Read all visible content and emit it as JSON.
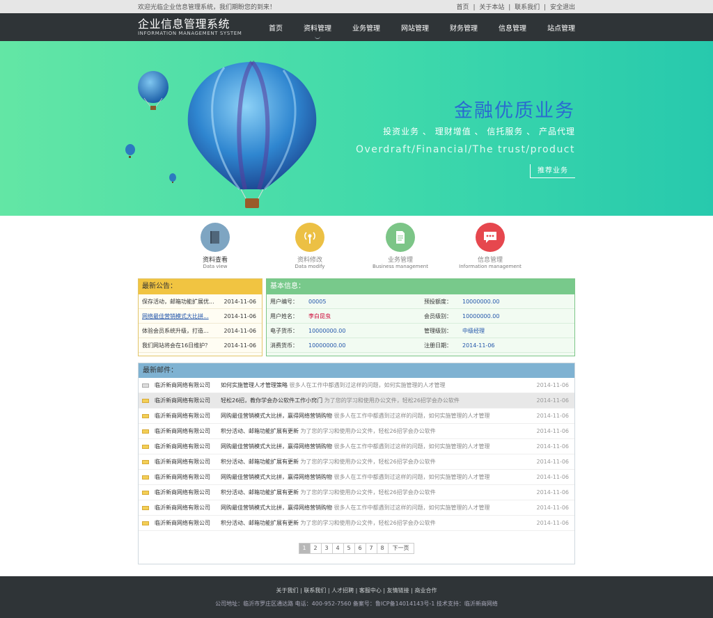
{
  "topbar": {
    "welcome": "欢迎光临企业信息管理系统，我们期盼您的到来！",
    "links": [
      "首页",
      "|",
      "关于本站",
      "|",
      "联系我们",
      "|",
      "安全退出"
    ]
  },
  "header": {
    "title": "企业信息管理系统",
    "subtitle": "INFORMATION MANAGEMENT SYSTEM"
  },
  "nav": [
    "首页",
    "资料管理",
    "业务管理",
    "网站管理",
    "财务管理",
    "信息管理",
    "站点管理"
  ],
  "banner": {
    "title": "金融优质业务",
    "services": "投资业务 、 理财增值 、 信托服务 、 产品代理",
    "english": "Overdraft/Financial/The trust/product",
    "button": "推荐业务"
  },
  "features": [
    {
      "cn": "资料查看",
      "en": "Data view",
      "color": "#7ea5c2",
      "icon": "book-icon"
    },
    {
      "cn": "资料修改",
      "en": "Data modify",
      "color": "#ecc044",
      "icon": "signal-icon"
    },
    {
      "cn": "业务管理",
      "en": "Business management",
      "color": "#7cc587",
      "icon": "document-icon"
    },
    {
      "cn": "信息管理",
      "en": "Information management",
      "color": "#e6474e",
      "icon": "chat-icon"
    }
  ],
  "notice": {
    "title": "最新公告：",
    "rows": [
      {
        "text": "保存活动，邮箱功能扩展优...",
        "date": "2014-11-06"
      },
      {
        "text": "网络最佳营销模式大比拼...",
        "date": "2014-11-06"
      },
      {
        "text": "体验会员系统升级，打造...",
        "date": "2014-11-06"
      },
      {
        "text": "我们网站将会在16日维护？",
        "date": "2014-11-06"
      }
    ]
  },
  "info": {
    "title": "基本信息：",
    "rows": [
      [
        {
          "k": "用户编号：",
          "v": "00005"
        },
        {
          "k": "预投额度：",
          "v": "10000000.00"
        }
      ],
      [
        {
          "k": "用户姓名：",
          "v": "李白昆虫"
        },
        {
          "k": "会员级别：",
          "v": "10000000.00"
        }
      ],
      [
        {
          "k": "电子货币：",
          "v": "10000000.00"
        },
        {
          "k": "管理级别：",
          "v": "中级经理"
        }
      ],
      [
        {
          "k": "消费货币：",
          "v": "10000000.00"
        },
        {
          "k": "注册日期：",
          "v": "2014-11-06"
        }
      ]
    ]
  },
  "mails": {
    "title": "最新邮件：",
    "rows": [
      {
        "company": "临沂新商网络有限公司",
        "bold": "如何实施管理人才管理策略",
        "rest": "  很多人在工作中都遇到过这样的问题，如何实施管理的人才管理",
        "date": "2014-11-06"
      },
      {
        "company": "临沂新商网络有限公司",
        "bold": "轻松26招，教你学会办公软件工作小窍门",
        "rest": "  为了您的学习和使用办公文件，轻松26招学会办公软件",
        "date": "2014-11-06"
      },
      {
        "company": "临沂新商网络有限公司",
        "bold": "网购最佳营销模式大比拼，赢得网络营销购物",
        "rest": "  很多人在工作中都遇到过这样的问题，如何实施管理的人才管理",
        "date": "2014-11-06"
      },
      {
        "company": "临沂新商网络有限公司",
        "bold": "积分活动、邮箱功能扩展有更新",
        "rest": "  为了您的学习和使用办公文件，轻松26招学会办公软件",
        "date": "2014-11-06"
      },
      {
        "company": "临沂新商网络有限公司",
        "bold": "网购最佳营销模式大比拼，赢得网络营销购物",
        "rest": "  很多人在工作中都遇到过这样的问题，如何实施管理的人才管理",
        "date": "2014-11-06"
      },
      {
        "company": "临沂新商网络有限公司",
        "bold": "积分活动、邮箱功能扩展有更新",
        "rest": "  为了您的学习和使用办公文件，轻松26招学会办公软件",
        "date": "2014-11-06"
      },
      {
        "company": "临沂新商网络有限公司",
        "bold": "网购最佳营销模式大比拼，赢得网络营销购物",
        "rest": "  很多人在工作中都遇到过这样的问题，如何实施管理的人才管理",
        "date": "2014-11-06"
      },
      {
        "company": "临沂新商网络有限公司",
        "bold": "积分活动、邮箱功能扩展有更新",
        "rest": "  为了您的学习和使用办公文件，轻松26招学会办公软件",
        "date": "2014-11-06"
      },
      {
        "company": "临沂新商网络有限公司",
        "bold": "网购最佳营销模式大比拼，赢得网络营销购物",
        "rest": "  很多人在工作中都遇到过这样的问题，如何实施管理的人才管理",
        "date": "2014-11-06"
      },
      {
        "company": "临沂新商网络有限公司",
        "bold": "积分活动、邮箱功能扩展有更新",
        "rest": "  为了您的学习和使用办公文件，轻松26招学会办公软件",
        "date": "2014-11-06"
      }
    ]
  },
  "pager": [
    "1",
    "2",
    "3",
    "4",
    "5",
    "6",
    "7",
    "8",
    "下一页"
  ],
  "footer": {
    "links": "关于我们 | 联系我们 | 人才招聘 | 客服中心 | 友情链接 | 商业合作",
    "info": "公司地址：临沂市罗庄区通达路  电话：400-952-7560  备案号：鲁ICP备14014143号-1  技术支持：临沂新商网络"
  }
}
